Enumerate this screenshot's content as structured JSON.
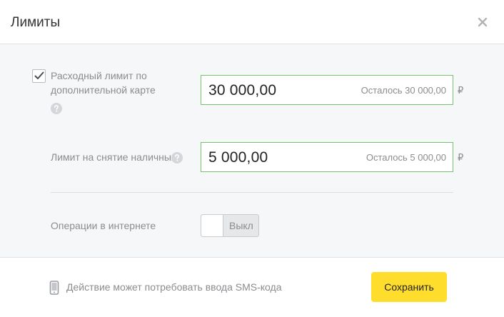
{
  "dialog": {
    "title": "Лимиты",
    "close_label": "×"
  },
  "limits": {
    "card_limit": {
      "checked": true,
      "label_line1": "Расходный лимит по",
      "label_line2": "дополнительной карте",
      "value": "30 000,00",
      "remaining": "Осталось 30 000,00",
      "currency": "₽"
    },
    "cash_limit": {
      "label": "Лимит на снятие наличных",
      "value": "5 000,00",
      "remaining": "Осталось 5 000,00",
      "currency": "₽"
    },
    "internet_ops": {
      "label": "Операции в интернете",
      "state": "Выкл"
    }
  },
  "footer": {
    "note": "Действие может потребовать ввода SMS-кода",
    "save_label": "Сохранить"
  },
  "colors": {
    "accent_button": "#ffdd2d",
    "field_border": "#74c46d"
  }
}
